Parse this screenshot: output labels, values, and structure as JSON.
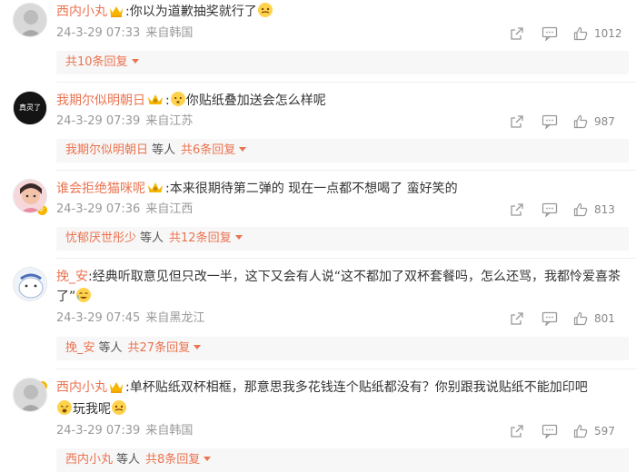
{
  "comments": [
    {
      "username": "西内小丸",
      "text": ":你以为道歉抽奖就行了",
      "timestamp": "24-3-29 07:33",
      "location": "来自韩国",
      "likes": "1012",
      "reply_users": "",
      "reply_suffix": "",
      "reply_count": "共10条回复"
    },
    {
      "username": "我期尔似明朝日",
      "text": "你贴纸叠加送会怎么样呢",
      "timestamp": "24-3-29 07:39",
      "location": "来自江苏",
      "likes": "987",
      "reply_users": "我期尔似明朝日",
      "reply_suffix": "等人",
      "reply_count": "共6条回复"
    },
    {
      "username": "谁会拒绝猫咪呢",
      "text": ":本来很期待第二弹的 现在一点都不想喝了 蛮好笑的",
      "timestamp": "24-3-29 07:36",
      "location": "来自江西",
      "likes": "813",
      "reply_users": "忧郁厌世彤少",
      "reply_suffix": "等人",
      "reply_count": "共12条回复"
    },
    {
      "username": "挽_安",
      "text": ":经典听取意见但只改一半，这下又会有人说“这不都加了双杯套餐吗，怎么还骂，我都怜爱喜茶了”",
      "timestamp": "24-3-29 07:45",
      "location": "来自黑龙江",
      "likes": "801",
      "reply_users": "挽_安",
      "reply_suffix": "等人",
      "reply_count": "共27条回复"
    },
    {
      "username": "西内小丸",
      "text": ":单杯贴纸双杯相框，那意思我多花钱连个贴纸都没有？你别跟我说贴纸不能加印吧",
      "text2": "玩我呢",
      "timestamp": "24-3-29 07:39",
      "location": "来自韩国",
      "likes": "597",
      "reply_users": "西内小丸",
      "reply_suffix": "等人",
      "reply_count": "共8条回复"
    }
  ],
  "avatar_text_2": "真灵了",
  "icons": [
    "crown-badge-icon",
    "verified-badge-icon",
    "share-icon",
    "comment-icon",
    "like-icon",
    "chevron-down-icon",
    "emoji-icon"
  ],
  "colors": {
    "username": "#eb7350",
    "meta": "#999999",
    "reply_bg": "#f7f7f7",
    "verified": "#f7b500"
  }
}
